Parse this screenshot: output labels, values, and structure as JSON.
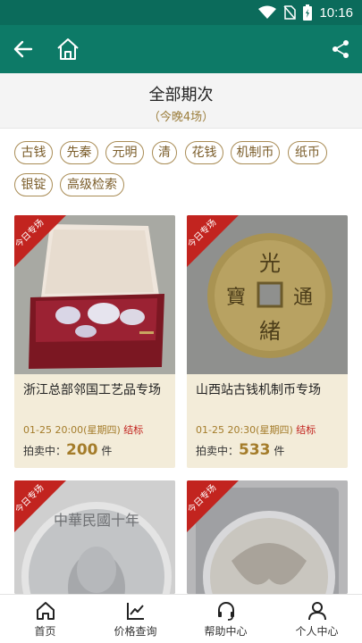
{
  "status_bar": {
    "time": "10:16"
  },
  "app_bar": {
    "back_icon": "arrow-left-icon",
    "home_icon": "home-icon",
    "share_icon": "share-icon"
  },
  "header": {
    "title": "全部期次",
    "subtitle": "（今晚4场）"
  },
  "filters": {
    "tags": [
      "古钱",
      "先秦",
      "元明",
      "清",
      "花钱",
      "机制币",
      "纸币",
      "银锭",
      "高级检索"
    ]
  },
  "cards": [
    {
      "ribbon": "今日专场",
      "title": "浙江总部邻国工艺品专场",
      "time": "01-25 20:00(星期四)",
      "status": "结标",
      "count_prefix": "拍卖中：",
      "count": "200",
      "count_unit": "件",
      "colors": {
        "bg": "#a8a9a3"
      }
    },
    {
      "ribbon": "今日专场",
      "title": "山西站古钱机制币专场",
      "time": "01-25 20:30(星期四)",
      "status": "结标",
      "count_prefix": "拍卖中：",
      "count": "533",
      "count_unit": "件",
      "colors": {
        "bg": "#8f908e"
      }
    },
    {
      "ribbon": "今日专场"
    },
    {
      "ribbon": "今日专场"
    }
  ],
  "tab_bar": {
    "items": [
      {
        "label": "首页",
        "icon": "home-icon"
      },
      {
        "label": "价格查询",
        "icon": "chart-icon"
      },
      {
        "label": "帮助中心",
        "icon": "headset-icon"
      },
      {
        "label": "个人中心",
        "icon": "user-icon"
      }
    ]
  },
  "colors": {
    "primary": "#0d7a67",
    "accent_gold": "#a47c2a",
    "ribbon_red": "#c2241f"
  }
}
